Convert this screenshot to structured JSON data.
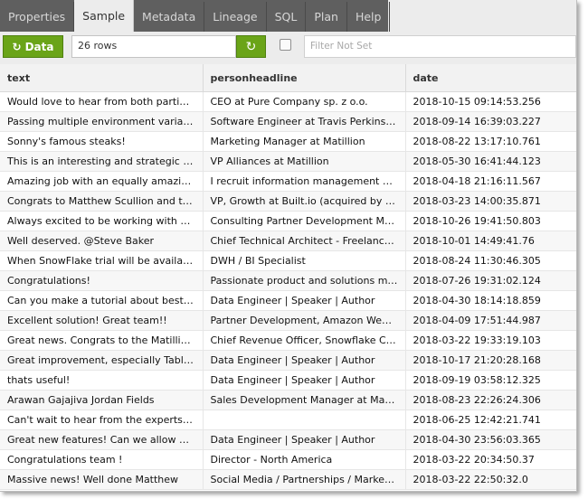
{
  "tabs": [
    "Properties",
    "Sample",
    "Metadata",
    "Lineage",
    "SQL",
    "Plan",
    "Help"
  ],
  "active_tab": 1,
  "toolbar": {
    "data_label": "Data",
    "rows_value": "26 rows",
    "filter_placeholder": "Filter Not Set"
  },
  "colors": {
    "accent": "#6aa418",
    "tab_dark": "#5f5f5f"
  },
  "table": {
    "columns": [
      "text",
      "personheadline",
      "date"
    ],
    "rows": [
      [
        "Would love to hear from both parties, ...",
        "CEO at Pure Company sp. z o.o.",
        "2018-10-15 09:14:53.256"
      ],
      [
        "Passing multiple environment variable...",
        "Software Engineer at Travis Perkins pl...",
        "2018-09-14 16:39:03.227"
      ],
      [
        "Sonny's famous steaks!",
        "Marketing Manager at Matillion",
        "2018-08-22 13:17:10.761"
      ],
      [
        "This is an interesting and strategic rol...",
        "VP Alliances at Matillion",
        "2018-05-30 16:41:44.123"
      ],
      [
        "Amazing job with an equally amazing ...",
        "I recruit information management an...",
        "2018-04-18 21:16:11.567"
      ],
      [
        "Congrats to Matthew Scullion and tea...",
        "VP, Growth at Built.io (acquired by So...",
        "2018-03-23 14:00:35.871"
      ],
      [
        "Always excited to be working with slal...",
        "Consulting Partner Development Ma...",
        "2018-10-26 19:41:50.803"
      ],
      [
        "Well deserved. @Steve Baker",
        "Chief Technical Architect - Freelance | ...",
        "2018-10-01 14:49:41.76"
      ],
      [
        "When SnowFlake trial will be available?",
        "DWH / BI Specialist",
        "2018-08-24 11:30:46.305"
      ],
      [
        "Congratulations!",
        "Passionate product and solutions ma...",
        "2018-07-26 19:31:02.124"
      ],
      [
        "Can you make a tutorial about best pr...",
        "Data Engineer | Speaker | Author",
        "2018-04-30 18:14:18.859"
      ],
      [
        "Excellent solution! Great team!!",
        "Partner Development, Amazon Web S...",
        "2018-04-09 17:51:44.987"
      ],
      [
        "Great news. Congrats to the Matillion ...",
        "Chief Revenue Officer, Snowflake Co...",
        "2018-03-22 19:33:19.103"
      ],
      [
        "Great improvement, especially Table ...",
        "Data Engineer | Speaker | Author",
        "2018-10-17 21:20:28.168"
      ],
      [
        "thats useful!",
        "Data Engineer | Speaker | Author",
        "2018-09-19 03:58:12.325"
      ],
      [
        "Arawan Gajajiva Jordan Fields",
        "Sales Development Manager at Matill...",
        "2018-08-23 22:26:24.306"
      ],
      [
        "Can't wait to hear from the experts Cr...",
        "",
        "2018-06-25 12:42:21.741"
      ],
      [
        "Great new features! Can we allow use...",
        "Data Engineer | Speaker | Author",
        "2018-04-30 23:56:03.365"
      ],
      [
        "Congratulations team !",
        "Director - North America",
        "2018-03-22 20:34:50.37"
      ],
      [
        "Massive news! Well done Matthew",
        "Social Media / Partnerships / Marketi...",
        "2018-03-22 22:50:32.0"
      ]
    ]
  }
}
